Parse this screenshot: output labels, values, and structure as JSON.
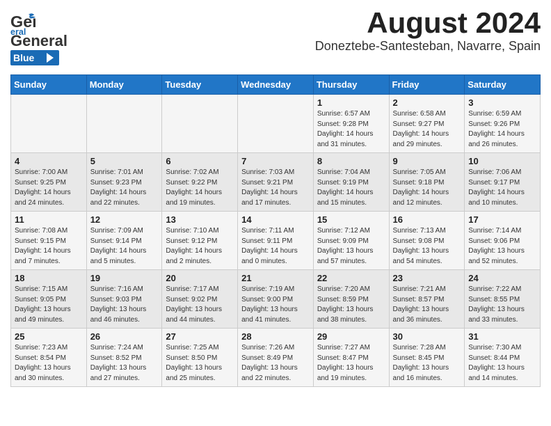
{
  "header": {
    "logo_general": "General",
    "logo_blue": "Blue",
    "month": "August 2024",
    "location": "Doneztebe-Santesteban, Navarre, Spain"
  },
  "weekdays": [
    "Sunday",
    "Monday",
    "Tuesday",
    "Wednesday",
    "Thursday",
    "Friday",
    "Saturday"
  ],
  "weeks": [
    [
      {
        "day": "",
        "info": ""
      },
      {
        "day": "",
        "info": ""
      },
      {
        "day": "",
        "info": ""
      },
      {
        "day": "",
        "info": ""
      },
      {
        "day": "1",
        "info": "Sunrise: 6:57 AM\nSunset: 9:28 PM\nDaylight: 14 hours\nand 31 minutes."
      },
      {
        "day": "2",
        "info": "Sunrise: 6:58 AM\nSunset: 9:27 PM\nDaylight: 14 hours\nand 29 minutes."
      },
      {
        "day": "3",
        "info": "Sunrise: 6:59 AM\nSunset: 9:26 PM\nDaylight: 14 hours\nand 26 minutes."
      }
    ],
    [
      {
        "day": "4",
        "info": "Sunrise: 7:00 AM\nSunset: 9:25 PM\nDaylight: 14 hours\nand 24 minutes."
      },
      {
        "day": "5",
        "info": "Sunrise: 7:01 AM\nSunset: 9:23 PM\nDaylight: 14 hours\nand 22 minutes."
      },
      {
        "day": "6",
        "info": "Sunrise: 7:02 AM\nSunset: 9:22 PM\nDaylight: 14 hours\nand 19 minutes."
      },
      {
        "day": "7",
        "info": "Sunrise: 7:03 AM\nSunset: 9:21 PM\nDaylight: 14 hours\nand 17 minutes."
      },
      {
        "day": "8",
        "info": "Sunrise: 7:04 AM\nSunset: 9:19 PM\nDaylight: 14 hours\nand 15 minutes."
      },
      {
        "day": "9",
        "info": "Sunrise: 7:05 AM\nSunset: 9:18 PM\nDaylight: 14 hours\nand 12 minutes."
      },
      {
        "day": "10",
        "info": "Sunrise: 7:06 AM\nSunset: 9:17 PM\nDaylight: 14 hours\nand 10 minutes."
      }
    ],
    [
      {
        "day": "11",
        "info": "Sunrise: 7:08 AM\nSunset: 9:15 PM\nDaylight: 14 hours\nand 7 minutes."
      },
      {
        "day": "12",
        "info": "Sunrise: 7:09 AM\nSunset: 9:14 PM\nDaylight: 14 hours\nand 5 minutes."
      },
      {
        "day": "13",
        "info": "Sunrise: 7:10 AM\nSunset: 9:12 PM\nDaylight: 14 hours\nand 2 minutes."
      },
      {
        "day": "14",
        "info": "Sunrise: 7:11 AM\nSunset: 9:11 PM\nDaylight: 14 hours\nand 0 minutes."
      },
      {
        "day": "15",
        "info": "Sunrise: 7:12 AM\nSunset: 9:09 PM\nDaylight: 13 hours\nand 57 minutes."
      },
      {
        "day": "16",
        "info": "Sunrise: 7:13 AM\nSunset: 9:08 PM\nDaylight: 13 hours\nand 54 minutes."
      },
      {
        "day": "17",
        "info": "Sunrise: 7:14 AM\nSunset: 9:06 PM\nDaylight: 13 hours\nand 52 minutes."
      }
    ],
    [
      {
        "day": "18",
        "info": "Sunrise: 7:15 AM\nSunset: 9:05 PM\nDaylight: 13 hours\nand 49 minutes."
      },
      {
        "day": "19",
        "info": "Sunrise: 7:16 AM\nSunset: 9:03 PM\nDaylight: 13 hours\nand 46 minutes."
      },
      {
        "day": "20",
        "info": "Sunrise: 7:17 AM\nSunset: 9:02 PM\nDaylight: 13 hours\nand 44 minutes."
      },
      {
        "day": "21",
        "info": "Sunrise: 7:19 AM\nSunset: 9:00 PM\nDaylight: 13 hours\nand 41 minutes."
      },
      {
        "day": "22",
        "info": "Sunrise: 7:20 AM\nSunset: 8:59 PM\nDaylight: 13 hours\nand 38 minutes."
      },
      {
        "day": "23",
        "info": "Sunrise: 7:21 AM\nSunset: 8:57 PM\nDaylight: 13 hours\nand 36 minutes."
      },
      {
        "day": "24",
        "info": "Sunrise: 7:22 AM\nSunset: 8:55 PM\nDaylight: 13 hours\nand 33 minutes."
      }
    ],
    [
      {
        "day": "25",
        "info": "Sunrise: 7:23 AM\nSunset: 8:54 PM\nDaylight: 13 hours\nand 30 minutes."
      },
      {
        "day": "26",
        "info": "Sunrise: 7:24 AM\nSunset: 8:52 PM\nDaylight: 13 hours\nand 27 minutes."
      },
      {
        "day": "27",
        "info": "Sunrise: 7:25 AM\nSunset: 8:50 PM\nDaylight: 13 hours\nand 25 minutes."
      },
      {
        "day": "28",
        "info": "Sunrise: 7:26 AM\nSunset: 8:49 PM\nDaylight: 13 hours\nand 22 minutes."
      },
      {
        "day": "29",
        "info": "Sunrise: 7:27 AM\nSunset: 8:47 PM\nDaylight: 13 hours\nand 19 minutes."
      },
      {
        "day": "30",
        "info": "Sunrise: 7:28 AM\nSunset: 8:45 PM\nDaylight: 13 hours\nand 16 minutes."
      },
      {
        "day": "31",
        "info": "Sunrise: 7:30 AM\nSunset: 8:44 PM\nDaylight: 13 hours\nand 14 minutes."
      }
    ]
  ]
}
